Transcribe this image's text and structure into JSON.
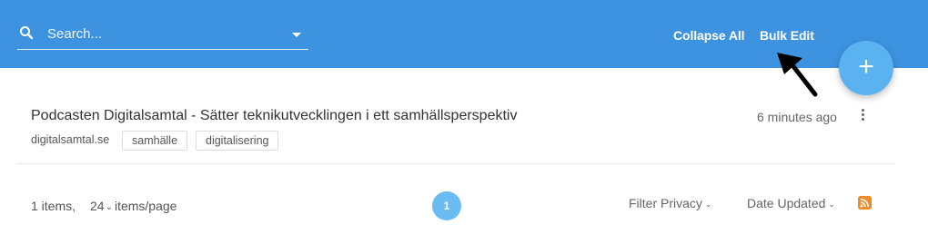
{
  "header": {
    "search": {
      "placeholder": "Search...",
      "value": ""
    },
    "collapse_all_label": "Collapse All",
    "bulk_edit_label": "Bulk Edit",
    "add_button_label": "+"
  },
  "items": [
    {
      "title": "Podcasten Digitalsamtal - Sätter teknikutvecklingen i ett samhällsperspektiv",
      "host": "digitalsamtal.se",
      "tags": [
        "samhälle",
        "digitalisering"
      ],
      "time": "6 minutes ago"
    }
  ],
  "footer": {
    "count_text": "1 items,",
    "per_page_value": "24",
    "per_page_suffix": "items/page",
    "current_page": "1",
    "filter_privacy_label": "Filter Privacy",
    "date_updated_label": "Date Updated"
  },
  "colors": {
    "header_bg": "#3d93e0",
    "fab_bg": "#5ab3f0",
    "page_btn_bg": "#6bbcf2",
    "rss_orange": "#f28b25"
  },
  "icons": {
    "search": "search-icon",
    "dropdown": "chevron-down-icon",
    "annotation": "arrow-pointer-icon",
    "more": "more-vertical-icon",
    "rss": "rss-icon"
  }
}
